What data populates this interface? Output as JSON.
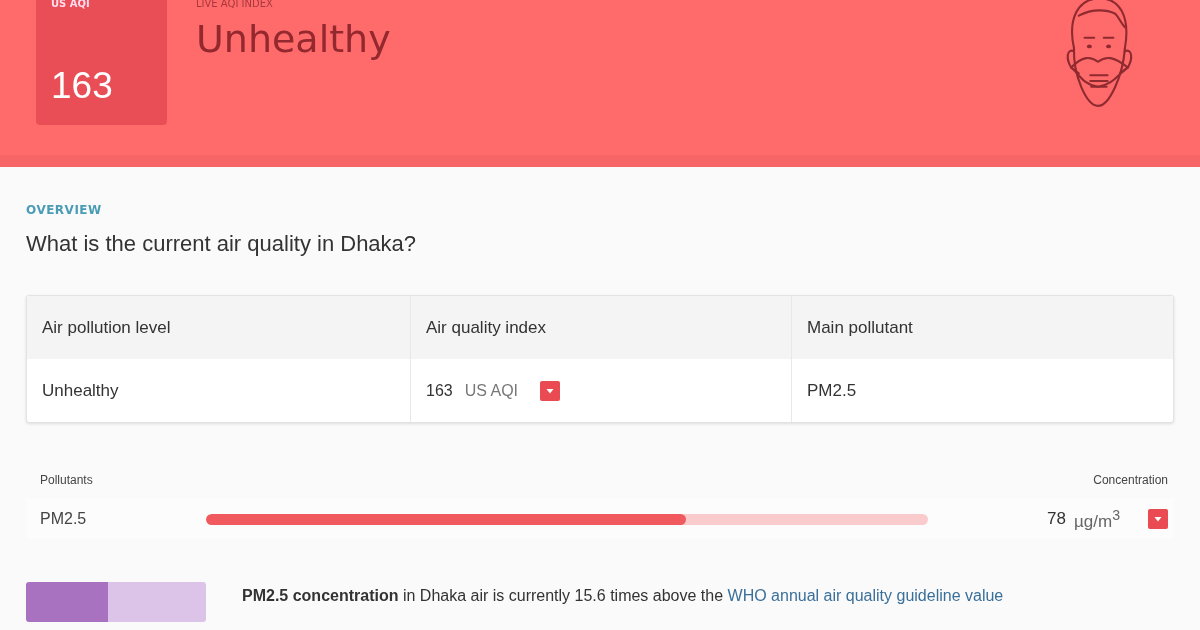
{
  "header": {
    "aqi_label": "US AQI",
    "aqi_value": "163",
    "index_label": "LIVE AQI INDEX",
    "status": "Unhealthy"
  },
  "overview": {
    "eyebrow": "OVERVIEW",
    "question": "What is the current air quality in Dhaka?"
  },
  "table": {
    "columns": [
      "Air pollution level",
      "Air quality index",
      "Main pollutant"
    ],
    "row": {
      "level": "Unhealthy",
      "aqi": "163",
      "aqi_unit": "US AQI",
      "pollutant": "PM2.5"
    }
  },
  "pollutants": {
    "label": "Pollutants",
    "concentration_label": "Concentration",
    "items": [
      {
        "name": "PM2.5",
        "level": 0.665,
        "value": "78",
        "unit": "µg/m$^{3}$"
      }
    ]
  },
  "summary": {
    "text": "**PM2.5 concentration** in Dhaka air is currently 15.6 times above the",
    "link": "WHO annual air quality guideline value"
  }
}
